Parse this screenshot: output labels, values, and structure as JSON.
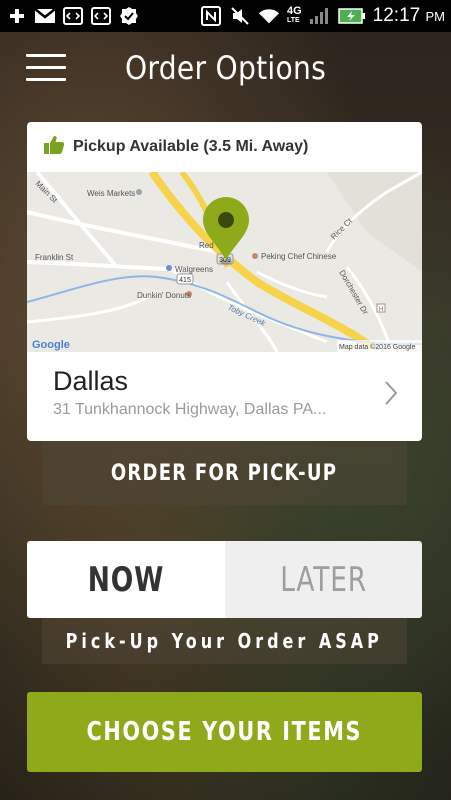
{
  "status_bar": {
    "time": "12:17",
    "ampm": "PM",
    "network": "4G",
    "network_sub": "LTE",
    "icons_left": [
      "add-icon",
      "gmail-icon",
      "code-icon",
      "code-icon",
      "check-badge-icon"
    ],
    "icons_right": [
      "nfc-icon",
      "mute-icon",
      "wifi-icon",
      "signal-icon",
      "battery-charging-icon"
    ]
  },
  "header": {
    "title": "Order Options"
  },
  "store_card": {
    "availability": "Pickup Available (3.5 Mi. Away)",
    "store_name": "Dallas",
    "store_address": "31 Tunkhannock Highway, Dallas PA...",
    "map": {
      "labels": {
        "weis": "Weis Markets",
        "main": "Main St",
        "franklin": "Franklin St",
        "walgreens": "Walgreens",
        "dunkin": "Dunkin' Donuts",
        "peking": "Peking Chef Chinese",
        "rice": "Rice Ct",
        "dorchester": "Dorchester Dr",
        "toby": "Toby Creek",
        "red": "Red",
        "route415": "415",
        "route309": "309",
        "h": "H",
        "google": "Google",
        "attribution": "Map data ©2016 Google"
      },
      "colors": {
        "highway": "#f5d34a",
        "water": "#8fb6e8",
        "pin": "#8eaa1a"
      }
    }
  },
  "pickup_button": {
    "label": "ORDER FOR PICK-UP"
  },
  "timing_toggle": {
    "options": [
      {
        "label": "NOW",
        "selected": true
      },
      {
        "label": "LATER",
        "selected": false
      }
    ],
    "hint": "Pick-Up Your Order ASAP"
  },
  "choose_button": {
    "label": "CHOOSE YOUR ITEMS"
  },
  "accent_color": "#8eaa1a"
}
